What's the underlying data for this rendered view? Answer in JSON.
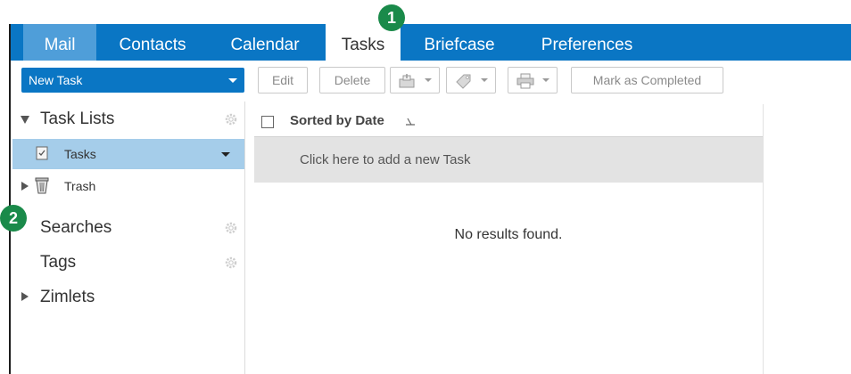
{
  "tabs": [
    {
      "label": "Mail"
    },
    {
      "label": "Contacts"
    },
    {
      "label": "Calendar"
    },
    {
      "label": "Tasks"
    },
    {
      "label": "Briefcase"
    },
    {
      "label": "Preferences"
    }
  ],
  "active_tab": "Tasks",
  "callouts": {
    "one": "1",
    "two": "2"
  },
  "toolbar": {
    "new_task": "New Task",
    "edit": "Edit",
    "delete": "Delete",
    "mark_completed": "Mark as Completed"
  },
  "sidebar": {
    "task_lists": "Task Lists",
    "items": [
      {
        "label": "Tasks",
        "icon": "task-list-icon",
        "selected": true
      },
      {
        "label": "Trash",
        "icon": "trash-icon",
        "selected": false
      }
    ],
    "searches": "Searches",
    "tags": "Tags",
    "zimlets": "Zimlets"
  },
  "list": {
    "sort_label": "Sorted by Date",
    "add_prompt": "Click here to add a new Task",
    "empty_message": "No results found."
  },
  "colors": {
    "brand_blue": "#0a76c4",
    "selection_blue": "#a5cdea",
    "callout_green": "#1a8a4a"
  }
}
